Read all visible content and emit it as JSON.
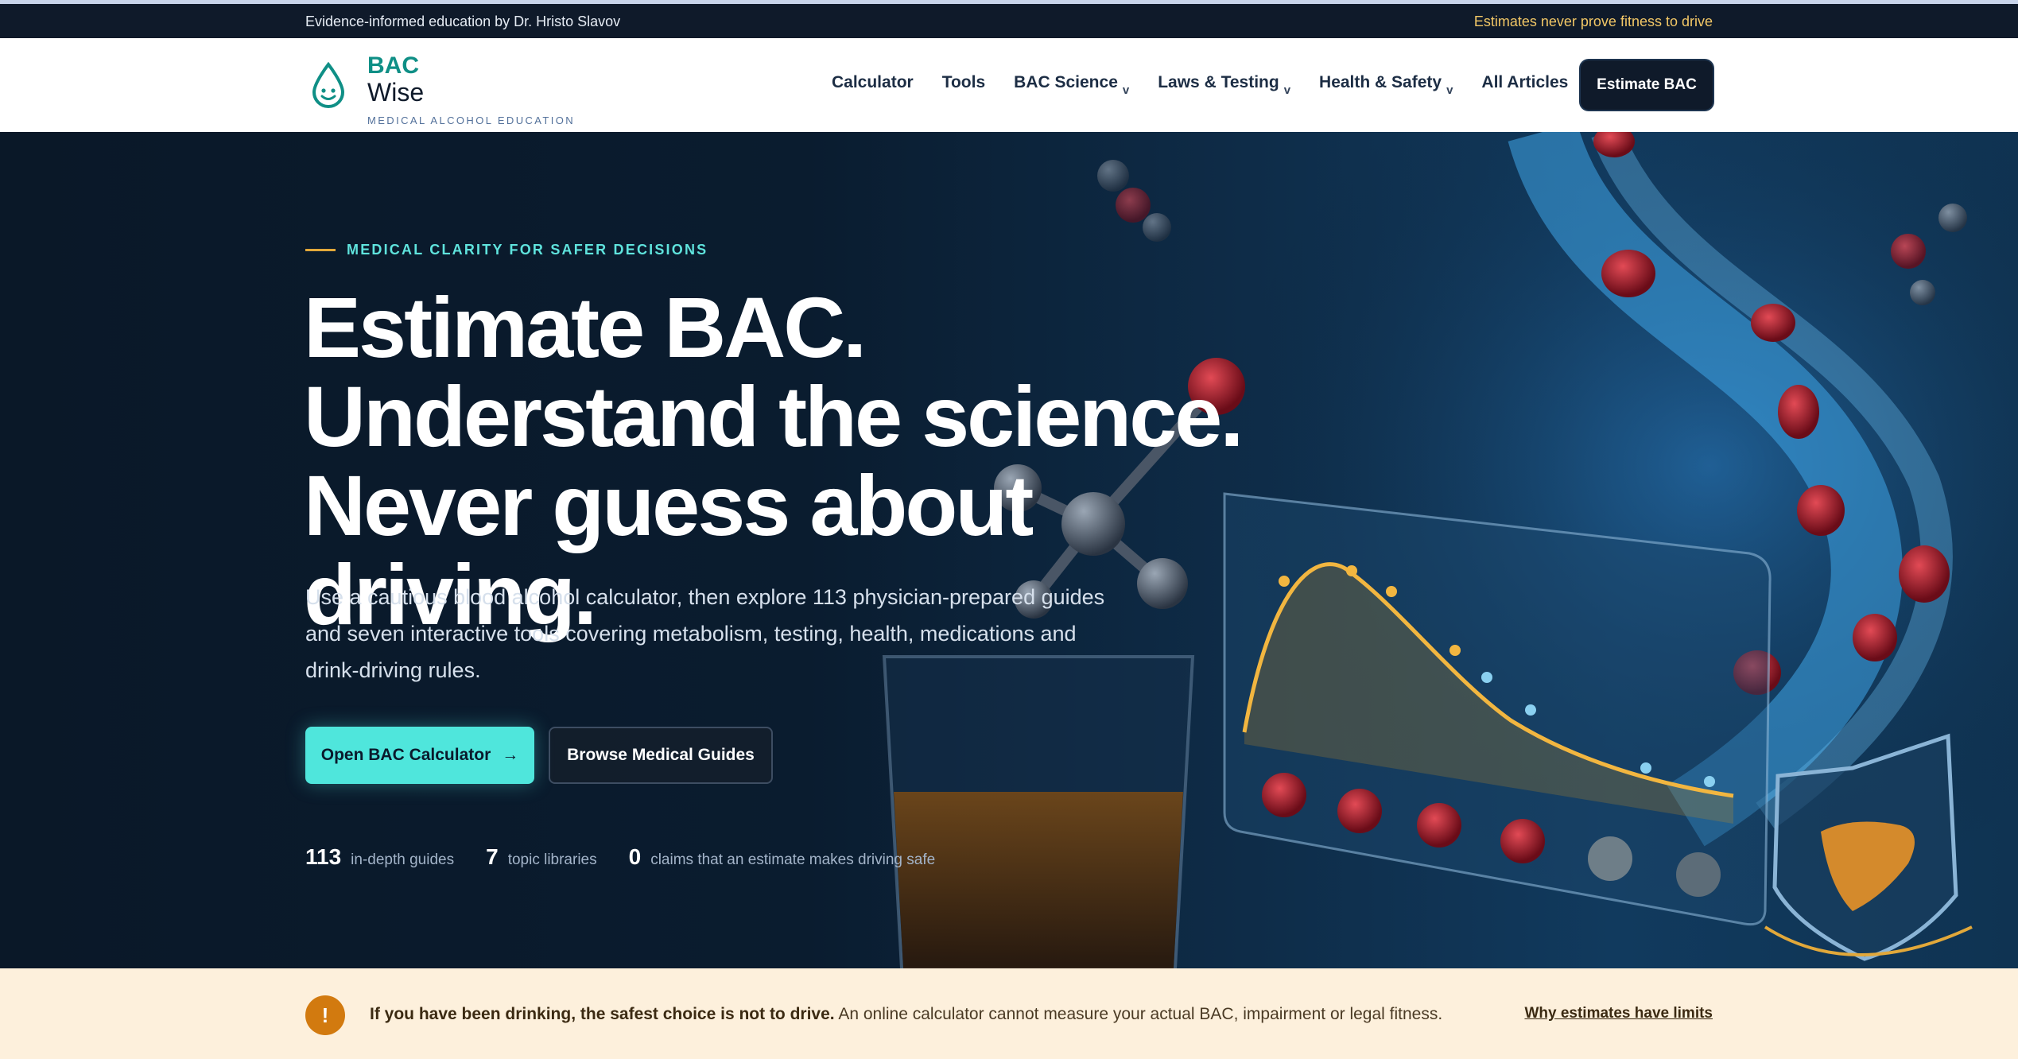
{
  "topbar": {
    "left_text": "Evidence-informed education by Dr. Hristo Slavov",
    "right_text": "Estimates never prove fitness to drive"
  },
  "brand": {
    "name_line1": "BAC",
    "name_line2": "Wise",
    "tagline": "MEDICAL ALCOHOL EDUCATION",
    "icon": "water-drop-smile-icon",
    "accent": "#0f8f86"
  },
  "nav": {
    "items": [
      {
        "label": "Calculator",
        "dropdown": false
      },
      {
        "label": "Tools",
        "dropdown": false
      },
      {
        "label": "BAC Science",
        "dropdown": true
      },
      {
        "label": "Laws & Testing",
        "dropdown": true
      },
      {
        "label": "Health & Safety",
        "dropdown": true
      },
      {
        "label": "All Articles",
        "dropdown": false
      }
    ],
    "chevron": "v",
    "cta_label": "Estimate BAC"
  },
  "hero": {
    "eyebrow": "MEDICAL CLARITY FOR SAFER DECISIONS",
    "headline": "Estimate BAC. Understand the science. Never guess about driving.",
    "lede": "Use a cautious blood alcohol calculator, then explore 113 physician-prepared guides and seven interactive tools covering metabolism, testing, health, medications and drink-driving rules.",
    "primary_button": "Open BAC Calculator",
    "primary_arrow": "→",
    "secondary_button": "Browse Medical Guides",
    "stats": [
      {
        "value": "113",
        "label": "in-depth guides"
      },
      {
        "value": "7",
        "label": "topic libraries"
      },
      {
        "value": "0",
        "label": "claims that an estimate makes driving safe"
      }
    ],
    "colors": {
      "cyan": "#4fe6dc",
      "gold": "#e2a83a"
    }
  },
  "alert": {
    "icon_glyph": "!",
    "bold_text": "If you have been drinking, the safest choice is not to drive.",
    "text": " An online calculator cannot measure your actual BAC, impairment or legal fitness.",
    "link": "Why estimates have limits",
    "color": "#d27a0f"
  }
}
